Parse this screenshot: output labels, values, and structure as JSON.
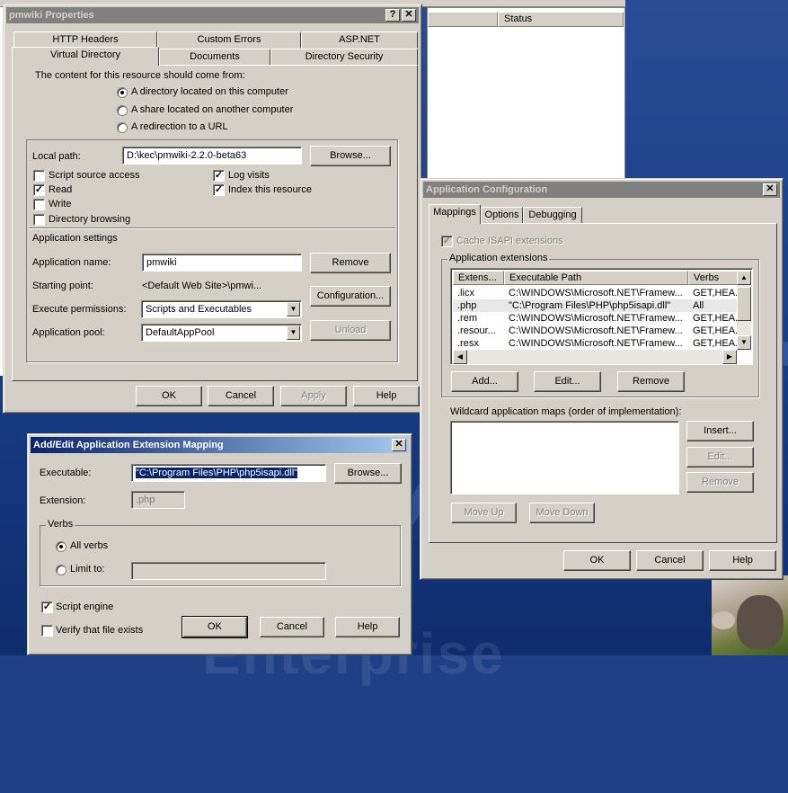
{
  "background_window": {
    "status_header": "Status"
  },
  "pm": {
    "title": "pmwiki Properties",
    "help_btn": "?",
    "close_btn": "✕",
    "tabs_row1": [
      "HTTP Headers",
      "Custom Errors",
      "ASP.NET"
    ],
    "tabs_row2": [
      "Virtual Directory",
      "Documents",
      "Directory Security"
    ],
    "source_label": "The content for this resource should come from:",
    "radio_options": [
      "A directory located on this computer",
      "A share located on another computer",
      "A redirection to a URL"
    ],
    "local_path_label": "Local path:",
    "local_path_value": "D:\\kec\\pmwiki-2.2.0-beta63",
    "browse_label": "Browse...",
    "check_left": [
      {
        "label": "Script source access",
        "checked": false
      },
      {
        "label": "Read",
        "checked": true
      },
      {
        "label": "Write",
        "checked": false
      },
      {
        "label": "Directory browsing",
        "checked": false
      }
    ],
    "check_right": [
      {
        "label": "Log visits",
        "checked": true
      },
      {
        "label": "Index this resource",
        "checked": true
      }
    ],
    "app_settings_label": "Application settings",
    "app_name_label": "Application name:",
    "app_name_value": "pmwiki",
    "remove_label": "Remove",
    "starting_point_label": "Starting point:",
    "starting_point_value": "<Default Web Site>\\pmwi...",
    "configuration_label": "Configuration...",
    "exec_perm_label": "Execute permissions:",
    "exec_perm_value": "Scripts and Executables",
    "app_pool_label": "Application pool:",
    "app_pool_value": "DefaultAppPool",
    "unload_label": "Unload",
    "ok": "OK",
    "cancel": "Cancel",
    "apply": "Apply",
    "help": "Help"
  },
  "ac": {
    "title": "Application Configuration",
    "close_btn": "✕",
    "tabs": [
      "Mappings",
      "Options",
      "Debugging"
    ],
    "cache_label": "Cache ISAPI extensions",
    "app_ext_label": "Application extensions",
    "columns": [
      "Extens...",
      "Executable Path",
      "Verbs"
    ],
    "rows": [
      {
        "ext": ".licx",
        "path": "C:\\WINDOWS\\Microsoft.NET\\Framew...",
        "verbs": "GET,HEA..."
      },
      {
        "ext": ".php",
        "path": "\"C:\\Program Files\\PHP\\php5isapi.dll\"",
        "verbs": "All"
      },
      {
        "ext": ".rem",
        "path": "C:\\WINDOWS\\Microsoft.NET\\Framew...",
        "verbs": "GET,HEA..."
      },
      {
        "ext": ".resour...",
        "path": "C:\\WINDOWS\\Microsoft.NET\\Framew...",
        "verbs": "GET,HEA..."
      },
      {
        "ext": ".resx",
        "path": "C:\\WINDOWS\\Microsoft.NET\\Framew...",
        "verbs": "GET,HEA..."
      }
    ],
    "add_label": "Add...",
    "edit_label": "Edit...",
    "remove_label": "Remove",
    "wildcard_label": "Wildcard application maps (order of implementation):",
    "insert_label": "Insert...",
    "wc_edit_label": "Edit...",
    "wc_remove_label": "Remove",
    "move_up_label": "Move Up",
    "move_down_label": "Move Down",
    "ok": "OK",
    "cancel": "Cancel",
    "help": "Help"
  },
  "ae": {
    "title": "Add/Edit Application Extension Mapping",
    "close_btn": "✕",
    "executable_label": "Executable:",
    "executable_value": "\"C:\\Program Files\\PHP\\php5isapi.dll\"",
    "browse_label": "Browse...",
    "extension_label": "Extension:",
    "extension_value": ".php",
    "verbs_label": "Verbs",
    "all_verbs_label": "All verbs",
    "limit_to_label": "Limit to:",
    "script_engine_label": "Script engine",
    "verify_label": "Verify that file exists",
    "ok": "OK",
    "cancel": "Cancel",
    "help": "Help"
  },
  "watermark": "Enterprise"
}
